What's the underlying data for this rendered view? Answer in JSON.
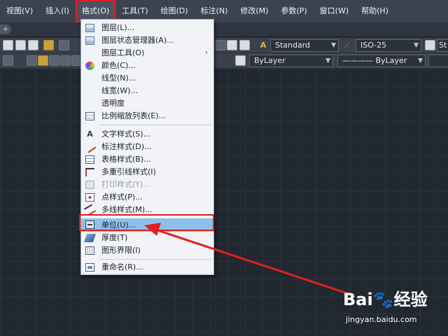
{
  "menubar": {
    "items": [
      {
        "label": "视图(V)"
      },
      {
        "label": "插入(I)"
      },
      {
        "label": "格式(O)"
      },
      {
        "label": "工具(T)"
      },
      {
        "label": "绘图(D)"
      },
      {
        "label": "标注(N)"
      },
      {
        "label": "修改(M)"
      },
      {
        "label": "参数(P)"
      },
      {
        "label": "窗口(W)"
      },
      {
        "label": "帮助(H)"
      }
    ],
    "active_item": "格式(O)"
  },
  "tabstrip": {
    "add_glyph": "+"
  },
  "toolbar1": {
    "text_style_value": "Standard",
    "dim_style_value": "ISO-25",
    "table_style_value": "St"
  },
  "toolbar2": {
    "layer_value": "ByLayer",
    "linetype_value": "———— ByLayer"
  },
  "format_menu": {
    "items": [
      {
        "label": "图层(L)...",
        "icon": "layer-icon"
      },
      {
        "label": "图层状态管理器(A)...",
        "icon": "layer-states-icon"
      },
      {
        "label": "图层工具(O)",
        "icon": "",
        "submenu_glyph": "›"
      },
      {
        "label": "颜色(C)...",
        "icon": "color-wheel-icon"
      },
      {
        "label": "线型(N)...",
        "icon": ""
      },
      {
        "label": "线宽(W)...",
        "icon": ""
      },
      {
        "label": "透明度",
        "icon": ""
      },
      {
        "label": "比例缩放列表(E)...",
        "icon": "scale-list-icon"
      },
      {
        "label": "文字样式(S)...",
        "icon": "text-style-icon"
      },
      {
        "label": "标注样式(D)...",
        "icon": "dim-style-icon"
      },
      {
        "label": "表格样式(B)...",
        "icon": "table-style-icon"
      },
      {
        "label": "多重引线样式(I)",
        "icon": "mleader-style-icon"
      },
      {
        "label": "打印样式(Y)...",
        "icon": "plot-style-icon",
        "disabled": true
      },
      {
        "label": "点样式(P)...",
        "icon": "point-style-icon"
      },
      {
        "label": "多线样式(M)...",
        "icon": "mline-style-icon"
      },
      {
        "label": "单位(U)...",
        "icon": "units-icon",
        "highlighted": true
      },
      {
        "label": "厚度(T)",
        "icon": "thickness-icon"
      },
      {
        "label": "图形界限(I)",
        "icon": "drawing-limits-icon"
      },
      {
        "label": "重命名(R)...",
        "icon": "rename-icon"
      }
    ]
  },
  "watermark": {
    "logo_text": "Bai",
    "logo_suffix": "经验",
    "url": "jingyan.baidu.com"
  },
  "colors": {
    "menubar_bg": "#3b4351",
    "canvas_bg": "#212830",
    "highlight_bg": "#8ec0ea",
    "annotation_red": "#e02020"
  }
}
